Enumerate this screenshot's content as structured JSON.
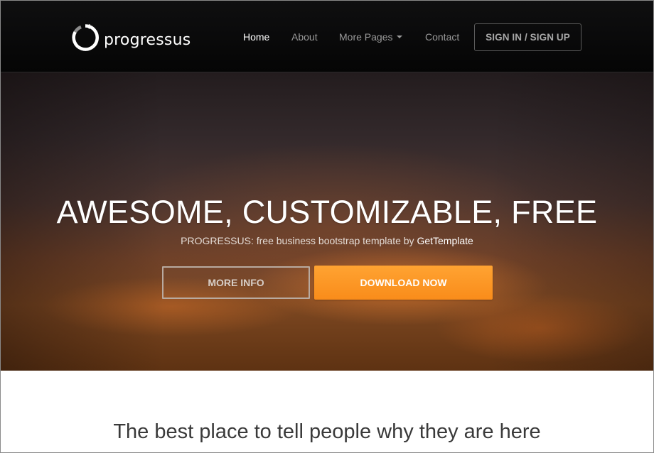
{
  "navbar": {
    "brand": {
      "name": "progressus",
      "logo_icon": "circular-arrow-logo"
    },
    "links": [
      {
        "label": "Home",
        "active": true
      },
      {
        "label": "About",
        "active": false
      },
      {
        "label": "More Pages",
        "active": false,
        "has_dropdown": true
      },
      {
        "label": "Contact",
        "active": false
      }
    ],
    "signin_label": "SIGN IN / SIGN UP"
  },
  "hero": {
    "title": "AWESOME, CUSTOMIZABLE, FREE",
    "subtitle_prefix": "PROGRESSUS: free business bootstrap template by",
    "subtitle_link": "GetTemplate",
    "primary_button": "MORE INFO",
    "cta_button": "DOWNLOAD NOW"
  },
  "section": {
    "heading": "The best place to tell people why they are here"
  },
  "colors": {
    "navbar_bg": "#0a0a0a",
    "accent": "#fd9a27",
    "hero_text": "#ffffff"
  }
}
